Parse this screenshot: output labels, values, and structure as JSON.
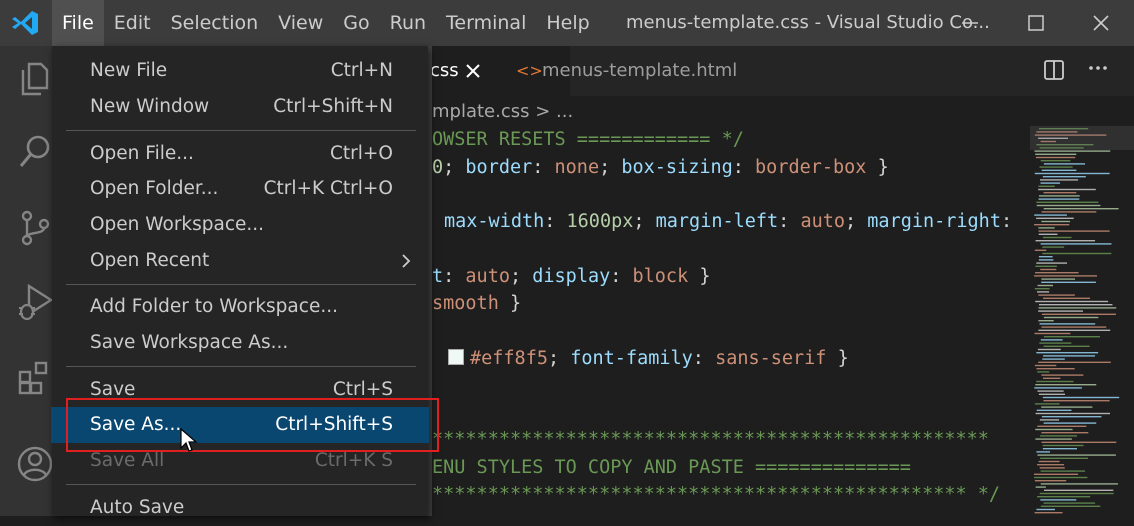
{
  "window": {
    "title": "menus-template.css - Visual Studio Co...",
    "accent": "#007acc"
  },
  "menubar": {
    "items": [
      "File",
      "Edit",
      "Selection",
      "View",
      "Go",
      "Run",
      "Terminal",
      "Help"
    ]
  },
  "activitybar": {
    "icons": [
      "files-icon",
      "search-icon",
      "source-control-icon",
      "run-debug-icon",
      "extensions-icon",
      "account-icon"
    ]
  },
  "tabs": [
    {
      "label": "css",
      "active": true
    },
    {
      "label": "menus-template.html",
      "active": false
    }
  ],
  "breadcrumb": "mplate.css > ...",
  "file_menu": {
    "items": [
      {
        "label": "New File",
        "shortcut": "Ctrl+N"
      },
      {
        "label": "New Window",
        "shortcut": "Ctrl+Shift+N"
      },
      {
        "label": "Open File...",
        "shortcut": "Ctrl+O"
      },
      {
        "label": "Open Folder...",
        "shortcut": "Ctrl+K Ctrl+O"
      },
      {
        "label": "Open Workspace...",
        "shortcut": ""
      },
      {
        "label": "Open Recent",
        "shortcut": ""
      },
      {
        "label": "Add Folder to Workspace...",
        "shortcut": ""
      },
      {
        "label": "Save Workspace As...",
        "shortcut": ""
      },
      {
        "label": "Save",
        "shortcut": "Ctrl+S"
      },
      {
        "label": "Save As...",
        "shortcut": "Ctrl+Shift+S"
      },
      {
        "label": "Save All",
        "shortcut": "Ctrl+K S"
      },
      {
        "label": "Auto Save",
        "shortcut": ""
      }
    ]
  },
  "code": {
    "line1_comment": "OWSER RESETS ============ */",
    "line2": {
      "a": "0",
      "p1": "border",
      "v1": "none",
      "p2": "box-sizing",
      "v2": "border-box"
    },
    "line3": {
      "p1": "max-width",
      "n1": "1600px",
      "p2": "margin-left",
      "v2": "auto",
      "p3": "margin-right"
    },
    "line4": {
      "p0": "t",
      "v0": "auto",
      "p1": "display",
      "v1": "block"
    },
    "line5": {
      "v": "smooth"
    },
    "line6": {
      "color": "#eff8f5",
      "p": "font-family",
      "v": "sans-serif"
    },
    "line7_comment": "**************************************************",
    "line8_comment": "ENU STYLES TO COPY AND PASTE ==============",
    "line9_comment": "************************************************ */"
  }
}
